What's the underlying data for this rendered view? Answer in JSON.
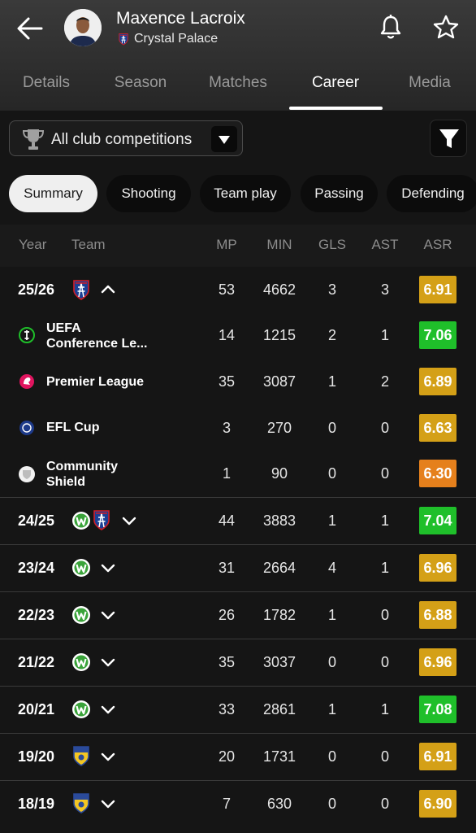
{
  "header": {
    "player_name": "Maxence Lacroix",
    "club_name": "Crystal Palace"
  },
  "tabs": [
    {
      "label": "Details"
    },
    {
      "label": "Season"
    },
    {
      "label": "Matches"
    },
    {
      "label": "Career",
      "active": true
    },
    {
      "label": "Media"
    }
  ],
  "filter": {
    "competition_label": "All club competitions"
  },
  "chips": [
    {
      "label": "Summary",
      "active": true
    },
    {
      "label": "Shooting"
    },
    {
      "label": "Team play"
    },
    {
      "label": "Passing"
    },
    {
      "label": "Defending"
    }
  ],
  "columns": {
    "year": "Year",
    "team": "Team",
    "mp": "MP",
    "min": "MIN",
    "gls": "GLS",
    "ast": "AST",
    "asr": "ASR"
  },
  "colors": {
    "rating_yellow": "#d4a017",
    "rating_green": "#1fbf2a",
    "rating_orange": "#e5801c"
  },
  "season_expanded": {
    "year": "25/26",
    "mp": "53",
    "min": "4662",
    "gls": "3",
    "ast": "3",
    "asr": "6.91",
    "asr_color": "#d4a017",
    "competitions": [
      {
        "name_line1": "UEFA",
        "name_line2": "Conference Le...",
        "icon": "conference-league-icon",
        "mp": "14",
        "min": "1215",
        "gls": "2",
        "ast": "1",
        "asr": "7.06",
        "asr_color": "#1fbf2a"
      },
      {
        "name_line1": "Premier League",
        "name_line2": "",
        "icon": "premier-league-icon",
        "mp": "35",
        "min": "3087",
        "gls": "1",
        "ast": "2",
        "asr": "6.89",
        "asr_color": "#d4a017"
      },
      {
        "name_line1": "EFL Cup",
        "name_line2": "",
        "icon": "efl-cup-icon",
        "mp": "3",
        "min": "270",
        "gls": "0",
        "ast": "0",
        "asr": "6.63",
        "asr_color": "#d4a017"
      },
      {
        "name_line1": "Community",
        "name_line2": "Shield",
        "icon": "community-shield-icon",
        "mp": "1",
        "min": "90",
        "gls": "0",
        "ast": "0",
        "asr": "6.30",
        "asr_color": "#e5801c"
      }
    ]
  },
  "seasons": [
    {
      "year": "24/25",
      "clubs": [
        "wolfsburg-crest-icon",
        "crystal-palace-crest-icon"
      ],
      "mp": "44",
      "min": "3883",
      "gls": "1",
      "ast": "1",
      "asr": "7.04",
      "asr_color": "#1fbf2a"
    },
    {
      "year": "23/24",
      "clubs": [
        "wolfsburg-crest-icon"
      ],
      "mp": "31",
      "min": "2664",
      "gls": "4",
      "ast": "1",
      "asr": "6.96",
      "asr_color": "#d4a017"
    },
    {
      "year": "22/23",
      "clubs": [
        "wolfsburg-crest-icon"
      ],
      "mp": "26",
      "min": "1782",
      "gls": "1",
      "ast": "0",
      "asr": "6.88",
      "asr_color": "#d4a017"
    },
    {
      "year": "21/22",
      "clubs": [
        "wolfsburg-crest-icon"
      ],
      "mp": "35",
      "min": "3037",
      "gls": "0",
      "ast": "0",
      "asr": "6.96",
      "asr_color": "#d4a017"
    },
    {
      "year": "20/21",
      "clubs": [
        "wolfsburg-crest-icon"
      ],
      "mp": "33",
      "min": "2861",
      "gls": "1",
      "ast": "1",
      "asr": "7.08",
      "asr_color": "#1fbf2a"
    },
    {
      "year": "19/20",
      "clubs": [
        "sochaux-crest-icon"
      ],
      "mp": "20",
      "min": "1731",
      "gls": "0",
      "ast": "0",
      "asr": "6.91",
      "asr_color": "#d4a017"
    },
    {
      "year": "18/19",
      "clubs": [
        "sochaux-crest-icon"
      ],
      "mp": "7",
      "min": "630",
      "gls": "0",
      "ast": "0",
      "asr": "6.90",
      "asr_color": "#d4a017"
    }
  ]
}
